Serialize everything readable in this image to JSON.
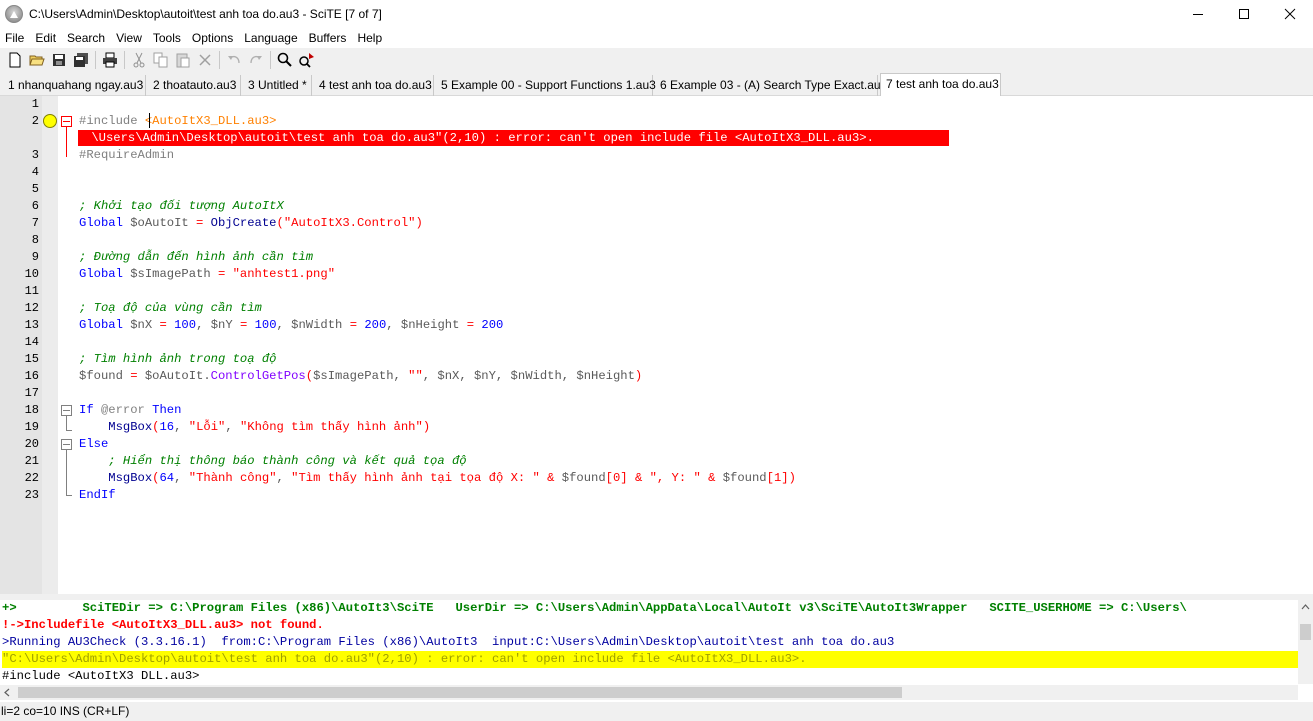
{
  "window": {
    "title": "C:\\Users\\Admin\\Desktop\\autoit\\test anh toa do.au3 - SciTE [7 of 7]",
    "app_icon": "scite-icon",
    "controls": [
      "minimize-icon",
      "maximize-icon",
      "close-icon"
    ]
  },
  "menu": [
    "File",
    "Edit",
    "Search",
    "View",
    "Tools",
    "Options",
    "Language",
    "Buffers",
    "Help"
  ],
  "toolbar": [
    "new-file-icon",
    "open-folder-icon",
    "save-icon",
    "save-all-icon",
    "print-icon",
    "cut-icon",
    "copy-icon",
    "paste-icon",
    "delete-icon",
    "undo-icon",
    "redo-icon",
    "find-icon",
    "replace-icon"
  ],
  "tabs": [
    {
      "label": "1 nhanquahang ngay.au3",
      "active": false
    },
    {
      "label": "2 thoatauto.au3",
      "active": false
    },
    {
      "label": "3 Untitled *",
      "active": false
    },
    {
      "label": "4 test anh toa do.au3",
      "active": false
    },
    {
      "label": "5 Example 00 - Support Functions 1.au3",
      "active": false
    },
    {
      "label": "6 Example 03 - (A) Search Type Exact.au3",
      "active": false
    },
    {
      "label": "7 test anh toa do.au3",
      "active": true
    }
  ],
  "editor": {
    "line_numbers": [
      "1",
      "2",
      "3",
      "4",
      "5",
      "6",
      "7",
      "8",
      "9",
      "10",
      "11",
      "12",
      "13",
      "14",
      "15",
      "16",
      "17",
      "18",
      "19",
      "20",
      "21",
      "22",
      "23"
    ],
    "inline_error": " \\Users\\Admin\\Desktop\\autoit\\test anh toa do.au3\"(2,10) : error: can't open include file <AutoItX3_DLL.au3>.",
    "code": {
      "l2_a": "#include ",
      "l2_b": "<AutoItX3_DLL.au3>",
      "l3": "#RequireAdmin",
      "l6": "; Khởi tạo đối tượng AutoItX",
      "l7_kw": "Global",
      "l7_var": " $oAutoIt ",
      "l7_op": "=",
      "l7_fn": " ObjCreate",
      "l7_p": "(",
      "l7_str": "\"AutoItX3.Control\"",
      "l7_e": ")",
      "l9": "; Đường dẫn đến hình ảnh cần tìm",
      "l10_kw": "Global",
      "l10_var": " $sImagePath ",
      "l10_op": "=",
      "l10_str": " \"anhtest1.png\"",
      "l12": "; Toạ độ của vùng cần tìm",
      "l13_kw": "Global",
      "l13_rest": [
        " $nX ",
        "=",
        " 100",
        ", $nY ",
        "=",
        " 100",
        ", $nWidth ",
        "=",
        " 200",
        ", $nHeight ",
        "=",
        " 200"
      ],
      "l15": "; Tìm hình ảnh trong toạ độ",
      "l16_var": "$found ",
      "l16_op": "=",
      "l16_obj": " $oAutoIt.",
      "l16_m": "ControlGetPos",
      "l16_p1": "(",
      "l16_args": "$sImagePath, ",
      "l16_s": "\"\"",
      "l16_args2": ", $nX, $nY, $nWidth, $nHeight",
      "l16_p2": ")",
      "l18_kw": "If",
      "l18_mac": " @error",
      "l18_kw2": " Then",
      "l19_fn": "    MsgBox",
      "l19_a": "(",
      "l19_n": "16",
      "l19_b": ", ",
      "l19_s1": "\"Lỗi\"",
      "l19_c": ", ",
      "l19_s2": "\"Không tìm thấy hình ảnh\"",
      "l19_d": ")",
      "l20": "Else",
      "l21": "    ; Hiển thị thông báo thành công và kết quả tọa độ",
      "l22_fn": "    MsgBox",
      "l22_a": "(",
      "l22_n": "64",
      "l22_b": ", ",
      "l22_s1": "\"Thành công\"",
      "l22_c": ", ",
      "l22_s2": "\"Tìm thấy hình ảnh tại tọa độ X: \"",
      "l22_amp1": " & ",
      "l22_v1": "$found",
      "l22_i1": "[0]",
      "l22_amp2": " & ",
      "l22_s3": "\", Y: \"",
      "l22_amp3": " & ",
      "l22_v2": "$found",
      "l22_i2": "[1]",
      "l22_d": ")",
      "l23": "EndIf"
    }
  },
  "output": {
    "line1": "+>         SciTEDir => C:\\Program Files (x86)\\AutoIt3\\SciTE   UserDir => C:\\Users\\Admin\\AppData\\Local\\AutoIt v3\\SciTE\\AutoIt3Wrapper   SCITE_USERHOME => C:\\Users\\",
    "line2": "!->Includefile <AutoItX3_DLL.au3> not found.",
    "line3": ">Running AU3Check (3.3.16.1)  from:C:\\Program Files (x86)\\AutoIt3  input:C:\\Users\\Admin\\Desktop\\autoit\\test anh toa do.au3",
    "line4": "\"C:\\Users\\Admin\\Desktop\\autoit\\test anh toa do.au3\"(2,10) : error: can't open include file <AutoItX3_DLL.au3>.",
    "line5": "#include <AutoItX3 DLL.au3>"
  },
  "status": "li=2 co=10 INS (CR+LF)"
}
